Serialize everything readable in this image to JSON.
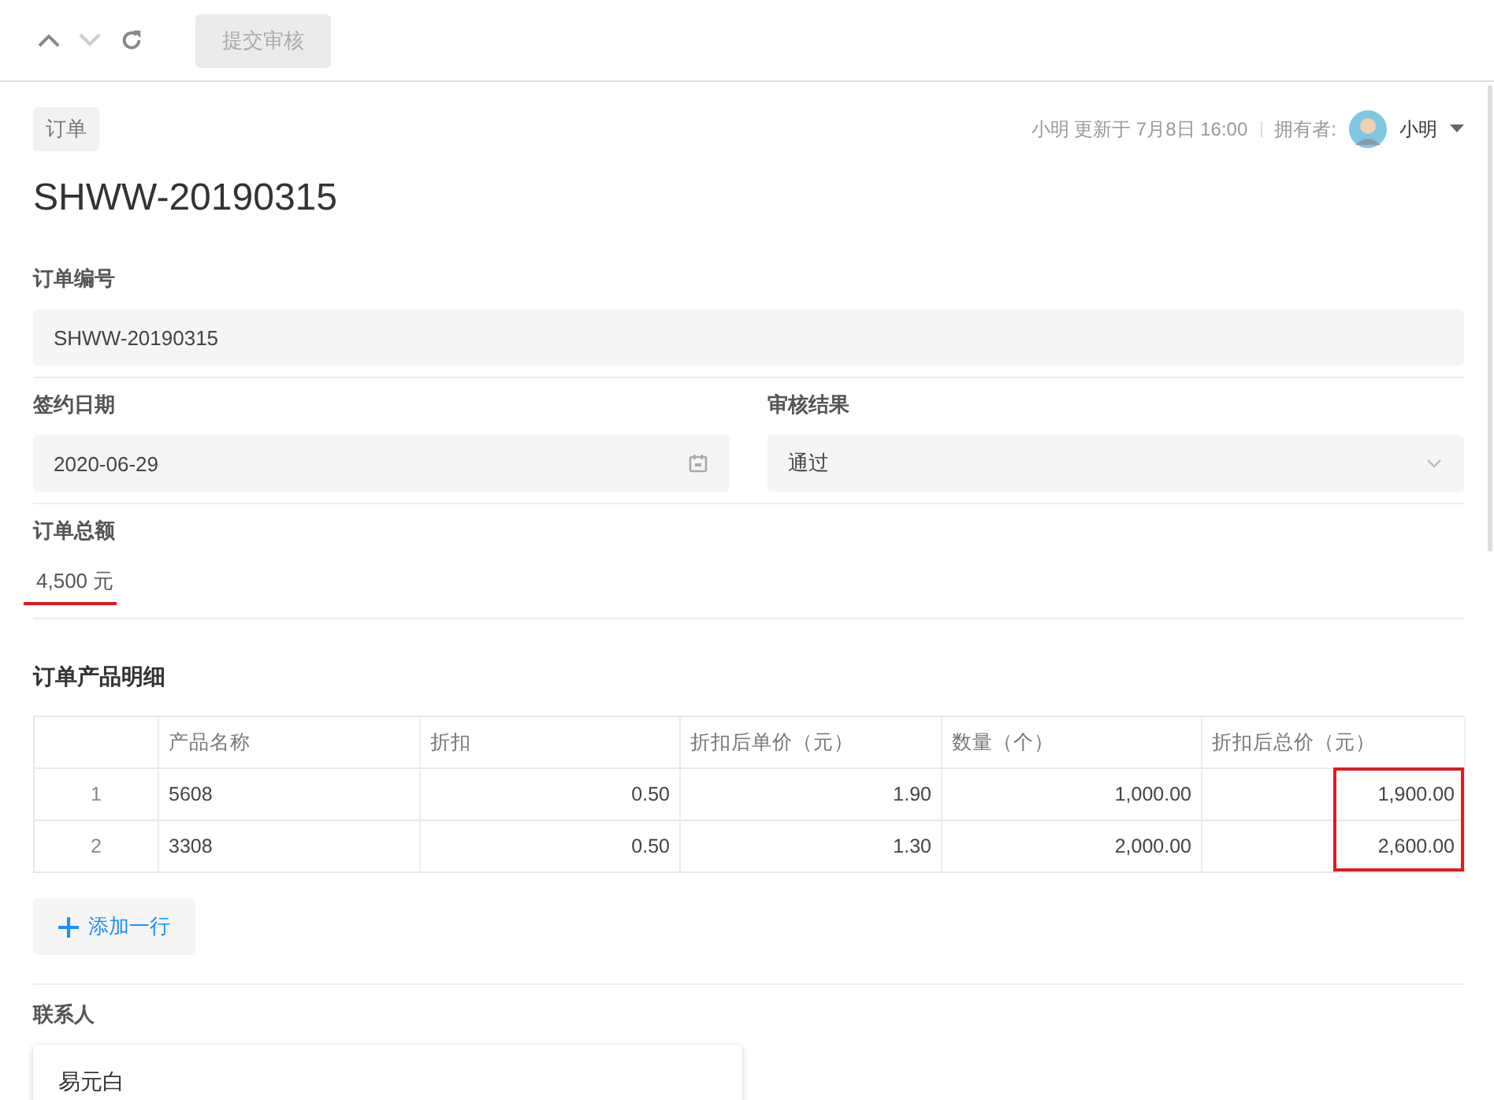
{
  "toolbar": {
    "nav": [
      {
        "kind": "up",
        "disabled": false
      },
      {
        "kind": "down",
        "disabled": true
      },
      {
        "kind": "refresh",
        "disabled": false
      }
    ],
    "submit": {
      "label": "提交审核",
      "disabled": true
    }
  },
  "header": {
    "tag": "订单",
    "updated": "小明 更新于 7月8日 16:00",
    "owner_label": "拥有者:",
    "owner": "小明",
    "title": "SHWW-20190315"
  },
  "fields": {
    "order_no": {
      "label": "订单编号",
      "value": "SHWW-20190315"
    },
    "sign_date": {
      "label": "签约日期",
      "value": "2020-06-29"
    },
    "review": {
      "label": "审核结果",
      "value": "通过"
    },
    "amount": {
      "label": "订单总额",
      "value": "4,500 元",
      "underlined": true
    }
  },
  "details": {
    "title": "订单产品明细",
    "columns": [
      "",
      "产品名称",
      "折扣",
      "折扣后单价（元）",
      "数量（个）",
      "折扣后总价（元）"
    ],
    "highlight_last_column": true,
    "rows": [
      [
        "1",
        "5608",
        "0.50",
        "1.90",
        "1,000.00",
        "1,900.00"
      ],
      [
        "2",
        "3308",
        "0.50",
        "1.30",
        "2,000.00",
        "2,600.00"
      ]
    ],
    "add_row": "添加一行"
  },
  "contact": {
    "label": "联系人",
    "value": "易元白"
  }
}
